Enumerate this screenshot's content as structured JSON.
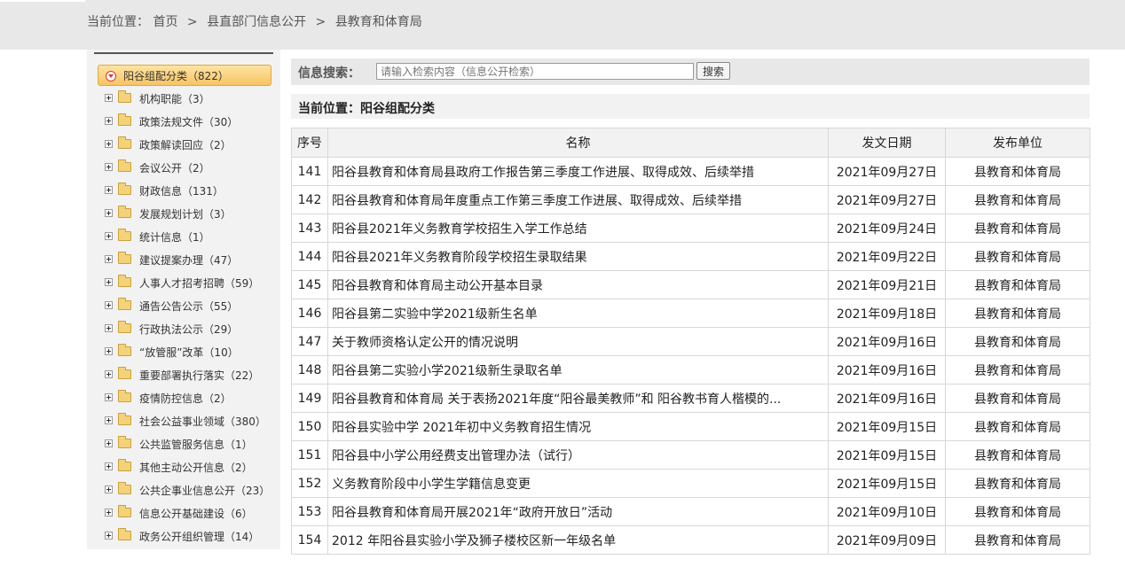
{
  "breadcrumb": {
    "prefix": "当前位置：",
    "home": "首页",
    "sep1": ">",
    "dept": "县直部门信息公开",
    "sep2": ">",
    "current": "县教育和体育局"
  },
  "sidebar": {
    "root": "阳谷组配分类（822）",
    "items": [
      "机构职能（3）",
      "政策法规文件（30）",
      "政策解读回应（2）",
      "会议公开（2）",
      "财政信息（131）",
      "发展规划计划（3）",
      "统计信息（1）",
      "建议提案办理（47）",
      "人事人才招考招聘（59）",
      "通告公告公示（55）",
      "行政执法公示（29）",
      "“放管服”改革（10）",
      "重要部署执行落实（22）",
      "疫情防控信息（2）",
      "社会公益事业领域（380）",
      "公共监管服务信息（1）",
      "其他主动公开信息（2）",
      "公共企事业信息公开（23）",
      "信息公开基础建设（6）",
      "政务公开组织管理（14）"
    ]
  },
  "search": {
    "label": "信息搜索：",
    "placeholder": "请输入检索内容（信息公开检索）",
    "button": "搜索"
  },
  "position": {
    "text": "当前位置：阳谷组配分类"
  },
  "table": {
    "headers": [
      "序号",
      "名称",
      "发文日期",
      "发布单位"
    ],
    "rows": [
      [
        "141",
        "阳谷县教育和体育局县政府工作报告第三季度工作进展、取得成效、后续举措",
        "2021年09月27日",
        "县教育和体育局"
      ],
      [
        "142",
        "阳谷县教育和体育局年度重点工作第三季度工作进展、取得成效、后续举措",
        "2021年09月27日",
        "县教育和体育局"
      ],
      [
        "143",
        "阳谷县2021年义务教育学校招生入学工作总结",
        "2021年09月24日",
        "县教育和体育局"
      ],
      [
        "144",
        "阳谷县2021年义务教育阶段学校招生录取结果",
        "2021年09月22日",
        "县教育和体育局"
      ],
      [
        "145",
        "阳谷县教育和体育局主动公开基本目录",
        "2021年09月21日",
        "县教育和体育局"
      ],
      [
        "146",
        "阳谷县第二实验中学2021级新生名单",
        "2021年09月18日",
        "县教育和体育局"
      ],
      [
        "147",
        "关于教师资格认定公开的情况说明",
        "2021年09月16日",
        "县教育和体育局"
      ],
      [
        "148",
        "阳谷县第二实验小学2021级新生录取名单",
        "2021年09月16日",
        "县教育和体育局"
      ],
      [
        "149",
        "阳谷县教育和体育局 关于表扬2021年度“阳谷最美教师”和 阳谷教书育人楷模的...",
        "2021年09月16日",
        "县教育和体育局"
      ],
      [
        "150",
        "阳谷县实验中学 2021年初中义务教育招生情况",
        "2021年09月15日",
        "县教育和体育局"
      ],
      [
        "151",
        "阳谷县中小学公用经费支出管理办法（试行）",
        "2021年09月15日",
        "县教育和体育局"
      ],
      [
        "152",
        "义务教育阶段中小学生学籍信息变更",
        "2021年09月15日",
        "县教育和体育局"
      ],
      [
        "153",
        "阳谷县教育和体育局开展2021年“政府开放日”活动",
        "2021年09月10日",
        "县教育和体育局"
      ],
      [
        "154",
        "2012 年阳谷县实验小学及狮子楼校区新一年级名单",
        "2021年09月09日",
        "县教育和体育局"
      ]
    ]
  }
}
